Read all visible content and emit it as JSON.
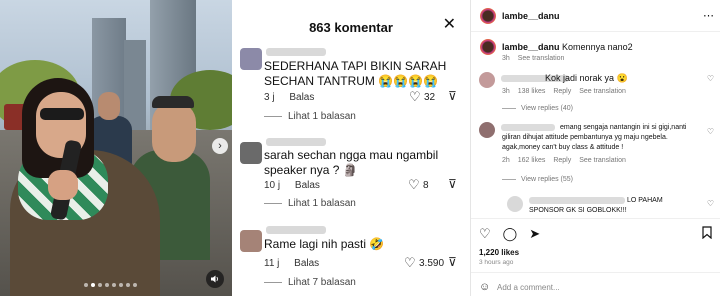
{
  "video": {
    "carousel_next": "›",
    "audio_icon": "speaker-icon",
    "dots_count": 8,
    "active_dot": 2
  },
  "comments_panel": {
    "title": "863 komentar",
    "close": "✕",
    "reply_label": "Balas",
    "comments": [
      {
        "text": "SEDERHANA TAPI BIKIN SARAH SECHAN TANTRUM 😭😭😭😭",
        "time": "3 j",
        "likes": "32",
        "replies": "Lihat 1 balasan",
        "avatar_color": "#8c8aa8"
      },
      {
        "text": "sarah sechan ngga mau ngambil speaker nya ? 🗿",
        "time": "10 j",
        "likes": "8",
        "replies": "Lihat 1 balasan",
        "avatar_color": "#6a6a6a"
      },
      {
        "text": "Rame lagi nih pasti 🤣",
        "time": "11 j",
        "likes": "3.590",
        "replies": "Lihat 7 balasan",
        "avatar_color": "#a58377"
      }
    ]
  },
  "instagram": {
    "username": "lambe__danu",
    "caption_user": "lambe__danu",
    "caption": "Komennya nano2",
    "caption_time": "3h",
    "see_translation": "See translation",
    "comments": [
      {
        "text": "Kok jadi norak ya 😮",
        "time": "3h",
        "likes": "138 likes",
        "reply": "Reply",
        "translate": "See translation",
        "view_replies": "View replies (40)"
      },
      {
        "text": "emang sengaja nantangin ini si gigi,nanti giliran dihujat attitude pembantunya yg maju ngebela. agak,money can't buy class & attitude !",
        "time": "2h",
        "likes": "162 likes",
        "reply": "Reply",
        "translate": "See translation",
        "view_replies": "View replies (55)"
      },
      {
        "text": "LO PAHAM SPONSOR GK SI GOBLOKK!!!"
      }
    ],
    "likes_count": "1,220 likes",
    "posted_ago": "3 hours ago",
    "add_comment_placeholder": "Add a comment...",
    "emoji_icon": "☺"
  }
}
